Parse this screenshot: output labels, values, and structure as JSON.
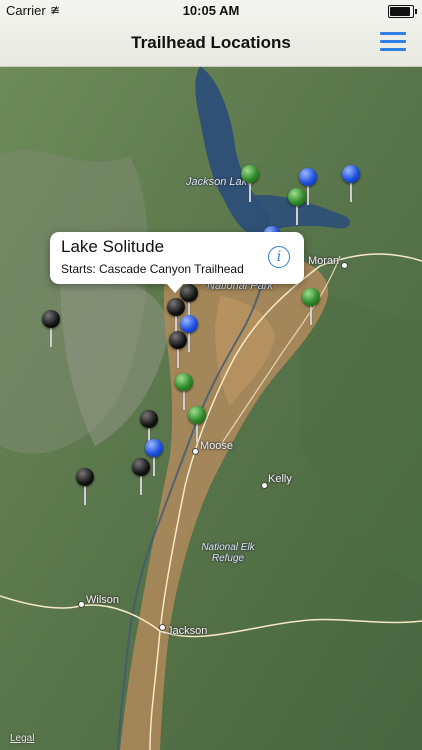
{
  "status_bar": {
    "carrier": "Carrier",
    "time": "10:05 AM"
  },
  "nav": {
    "title": "Trailhead Locations",
    "menu_icon": "hamburger-menu-icon"
  },
  "callout": {
    "title": "Lake Solitude",
    "subtitle": "Starts: Cascade Canyon Trailhead",
    "info_icon": "info-icon"
  },
  "map_labels": {
    "jackson_lake": "Jackson Lake",
    "moran": "Moran",
    "national_park": "National Park",
    "moose": "Moose",
    "kelly": "Kelly",
    "national_elk_refuge": "National Elk Refuge",
    "wilson": "Wilson",
    "jackson": "Jackson"
  },
  "legal_link": "Legal",
  "pin_colors": {
    "black": "#111111",
    "blue": "#1e4fe0",
    "green": "#2f8a2a"
  }
}
